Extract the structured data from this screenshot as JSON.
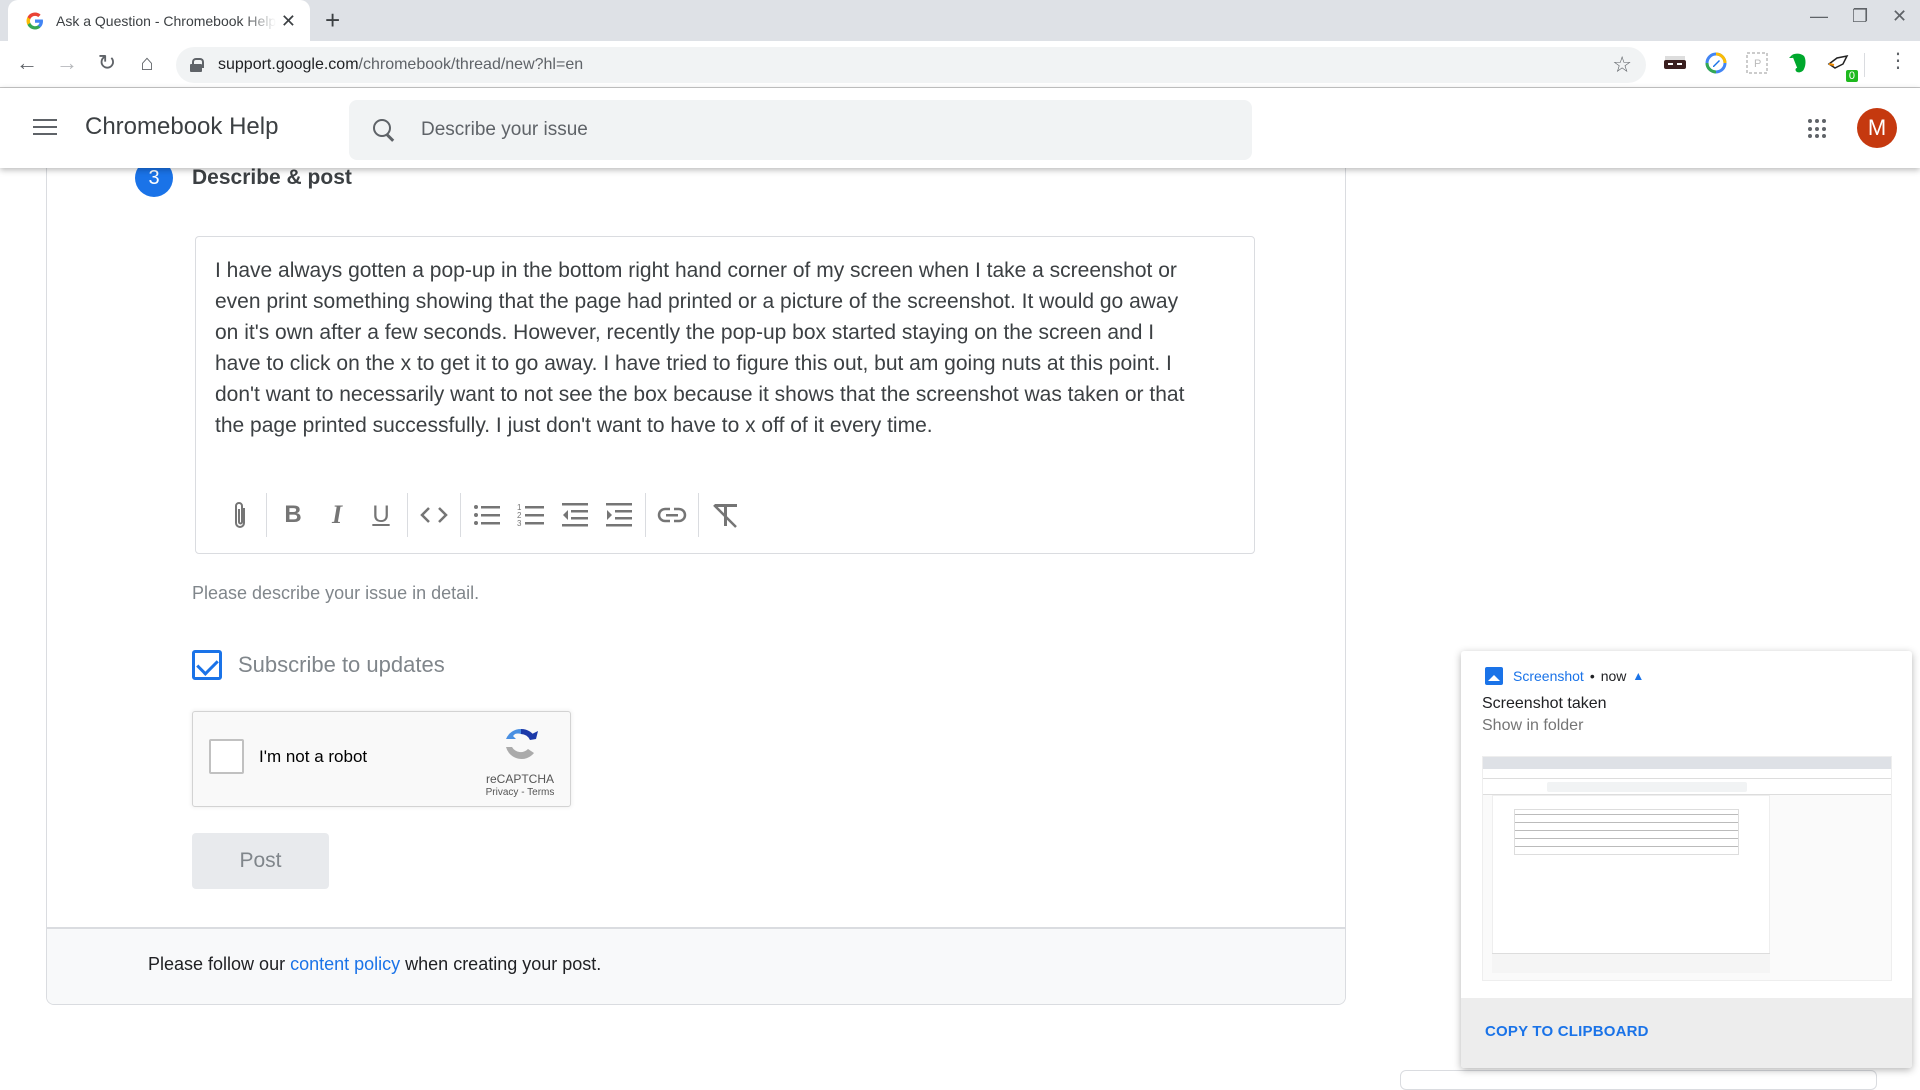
{
  "browser": {
    "tab": {
      "title": "Ask a Question - Chromebook Help",
      "favicon": "google-g-icon"
    },
    "new_tab_icon": "+",
    "window_controls": {
      "minimize": "—",
      "restore": "❐",
      "close": "✕"
    },
    "nav": {
      "back": "←",
      "forward": "→",
      "reload": "↻",
      "home": "⌂"
    },
    "url": {
      "host": "support.google.com",
      "path": "/chromebook/thread/new?hl=en"
    },
    "extensions": [
      {
        "name": "incognito-mask-extension",
        "glyph": "▬"
      },
      {
        "name": "pencil-extension",
        "glyph": "✎"
      },
      {
        "name": "placeholder-extension",
        "glyph": "P"
      },
      {
        "name": "evernote-extension",
        "glyph": "●"
      },
      {
        "name": "badge-extension",
        "glyph": "✈",
        "badge": "0"
      }
    ]
  },
  "header": {
    "app_title": "Chromebook Help",
    "search_placeholder": "Describe your issue",
    "avatar_initial": "M"
  },
  "form": {
    "step_number": "3",
    "step_title": "Describe & post",
    "body_lines": [
      "I have always gotten a pop-up in the bottom right hand corner of my screen when I take a screenshot or",
      "even print something showing that the page had printed or a picture of the screenshot.  It would go away",
      "on it's own after a few seconds.  However, recently the pop-up box started staying on the screen and I",
      "have to click on the x to get it to go away.  I have tried to figure this out, but am going nuts at this point.  I",
      "don't want to necessarily want to not see the box because it shows that the screenshot was taken or that",
      "the page printed successfully.  I just don't want to have to x off of it every time."
    ],
    "toolbar": [
      "attach",
      "bold",
      "italic",
      "underline",
      "code",
      "bulleted-list",
      "numbered-list",
      "outdent",
      "indent",
      "link",
      "clear-formatting"
    ],
    "helper_text": "Please describe your issue in detail.",
    "subscribe_label": "Subscribe to updates",
    "subscribe_checked": true,
    "recaptcha": {
      "label": "I'm not a robot",
      "brand": "reCAPTCHA",
      "privacy": "Privacy",
      "separator": " - ",
      "terms": "Terms"
    },
    "post_label": "Post"
  },
  "footer": {
    "prefix": "Please follow our ",
    "link": "content policy",
    "suffix": " when creating your post."
  },
  "notification": {
    "app": "Screenshot",
    "dot": "•",
    "time": "now",
    "title": "Screenshot taken",
    "message": "Show in folder",
    "action": "COPY TO CLIPBOARD"
  },
  "colors": {
    "accent": "#1a73e8",
    "avatar": "#c5390f",
    "post_disabled_bg": "#e8eaed"
  }
}
